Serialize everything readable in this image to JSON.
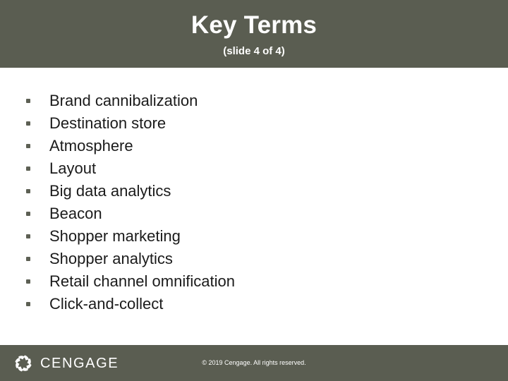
{
  "slide": {
    "title": "Key Terms",
    "subtitle": "(slide 4 of 4)",
    "colors": {
      "band": "#5a5d51",
      "background": "#ffffff",
      "title_text": "#ffffff",
      "body_text": "#1b1b1b",
      "bullet_marker": "#5d6054",
      "footer_text": "#ffffff"
    }
  },
  "key_terms": [
    {
      "label": "Brand cannibalization"
    },
    {
      "label": "Destination store"
    },
    {
      "label": "Atmosphere"
    },
    {
      "label": "Layout"
    },
    {
      "label": "Big data analytics"
    },
    {
      "label": "Beacon"
    },
    {
      "label": "Shopper marketing"
    },
    {
      "label": "Shopper analytics"
    },
    {
      "label": "Retail channel omnification"
    },
    {
      "label": "Click-and-collect"
    }
  ],
  "footer": {
    "logo_icon": "cengage-pinwheel-icon",
    "logo_wordmark": "CENGAGE",
    "copyright": "© 2019 Cengage. All rights reserved."
  }
}
